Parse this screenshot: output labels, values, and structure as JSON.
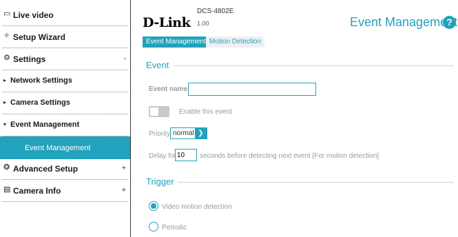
{
  "sidebar": {
    "items": [
      {
        "label": "Live video",
        "expander": ""
      },
      {
        "label": "Setup Wizard",
        "expander": ""
      },
      {
        "label": "Settings",
        "expander": "-"
      },
      {
        "label": "Network Settings",
        "bullet": "▸"
      },
      {
        "label": "Camera Settings",
        "bullet": "▸"
      },
      {
        "label": "Event Management",
        "bullet": "▾"
      },
      {
        "label": "Event Management"
      },
      {
        "label": "Advanced Setup",
        "expander": "+"
      },
      {
        "label": "Camera Info",
        "expander": "+"
      }
    ]
  },
  "header": {
    "brand": "D-Link",
    "model": "DCS-4802E",
    "firmware": "1.00",
    "title": "Event Management",
    "help": "?"
  },
  "tabs": [
    {
      "label": "Event Management",
      "active": true
    },
    {
      "label": "Motion Detection",
      "active": false
    }
  ],
  "event": {
    "heading": "Event",
    "name_label": "Event name:",
    "name_value": "",
    "enable_label": "Enable this event",
    "enabled": false,
    "priority_label": "Priority:",
    "priority_value": "normal",
    "delay_prefix": "Delay for",
    "delay_value": "10",
    "delay_suffix": "seconds before detecting next event [For motion detection]"
  },
  "trigger": {
    "heading": "Trigger",
    "options": [
      {
        "label": "Video motion detection",
        "selected": true
      },
      {
        "label": "Periodic",
        "selected": false
      }
    ]
  },
  "colors": {
    "accent": "#22a2bd",
    "text_muted": "#999999"
  },
  "icons": [
    "live-video-icon",
    "setup-wizard-icon",
    "settings-gear-icon",
    "advanced-setup-icon",
    "camera-info-icon",
    "help-icon",
    "dropdown-arrow-icon"
  ]
}
